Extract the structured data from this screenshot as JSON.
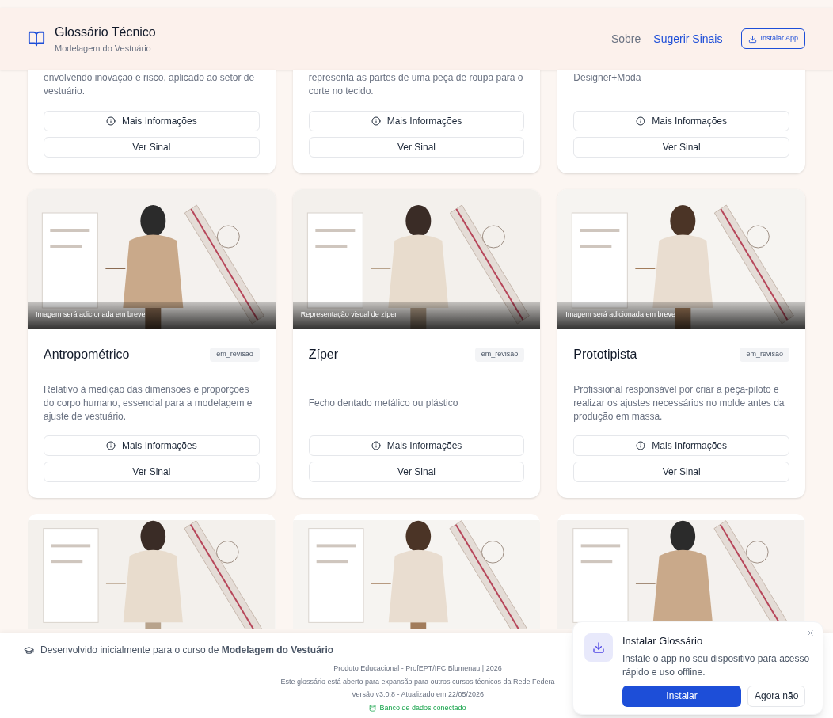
{
  "header": {
    "title": "Glossário Técnico",
    "subtitle": "Modelagem do Vestuário",
    "nav": [
      {
        "label": "Sobre",
        "selected": false
      },
      {
        "label": "Sugerir Sinais",
        "selected": true
      }
    ],
    "install_button": "Instalar App"
  },
  "cards_partial": [
    {
      "description": "envolvendo inovação e risco, aplicado ao setor de vestuário.",
      "more_button": "Mais Informações",
      "sign_button": "Ver Sinal"
    },
    {
      "description": "representa as partes de uma peça de roupa para o corte no tecido.",
      "more_button": "Mais Informações",
      "sign_button": "Ver Sinal"
    },
    {
      "description": "Designer+Moda",
      "more_button": "Mais Informações",
      "sign_button": "Ver Sinal"
    }
  ],
  "cards": [
    {
      "image": {
        "kind": "picture",
        "caption": "Imagem será adicionada em breve"
      },
      "title": "Antropométrico",
      "status": "em_revisao",
      "description": "Relativo à medição das dimensões e proporções do corpo humano, essencial para a modelagem e ajuste de vestuário.",
      "more_button": "Mais Informações",
      "sign_button": "Ver Sinal"
    },
    {
      "image": {
        "kind": "picture",
        "caption": "Representação visual de zíper"
      },
      "title": "Zíper",
      "status": "em_revisao",
      "description": "Fecho dentado metálico ou plástico",
      "more_button": "Mais Informações",
      "sign_button": "Ver Sinal"
    },
    {
      "image": {
        "kind": "picture",
        "caption": "Imagem será adicionada em breve"
      },
      "title": "Prototipista",
      "status": "em_revisao",
      "description": "Profissional responsável por criar a peça-piloto e realizar os ajustes necessários no molde antes da produção em massa.",
      "more_button": "Mais Informações",
      "sign_button": "Ver Sinal"
    }
  ],
  "footer": {
    "course_note": "Desenvolvido inicialmente para o curso de **Modelagem do Vestuário**",
    "lines": [
      "Produto Educacional - ProfEPT/IFC Blumenau | 2026",
      "Este glossário está aberto para expansão para outros cursos técnicos da Rede Federa",
      "Versão v3.0.8 - Atualizado em 22/05/2026"
    ],
    "database": {
      "text": "Banco de dados conectado",
      "connected": true
    }
  },
  "install_prompt": {
    "title": "Instalar Glossário",
    "message": "Instale o app no seu dispositivo para acesso rápido e uso offline.",
    "install_button": "Instalar",
    "dismiss_button": "Agora não"
  }
}
